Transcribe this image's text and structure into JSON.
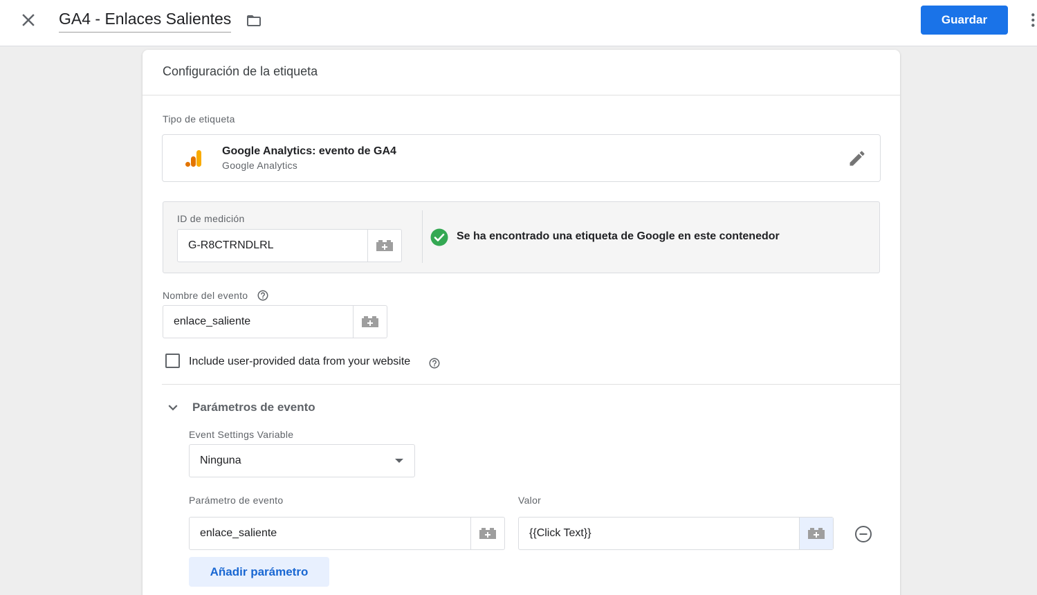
{
  "topbar": {
    "title": "GA4 - Enlaces Salientes",
    "save_label": "Guardar"
  },
  "card": {
    "title": "Configuración de la etiqueta",
    "tag_type_label": "Tipo de etiqueta",
    "tag_type": {
      "name": "Google Analytics: evento de GA4",
      "vendor": "Google Analytics"
    },
    "measurement_id": {
      "label": "ID de medición",
      "value": "G-R8CTRNDLRL",
      "status": "Se ha encontrado una etiqueta de Google en este contenedor"
    },
    "event_name": {
      "label": "Nombre del evento",
      "value": "enlace_saliente"
    },
    "user_data_checkbox": {
      "label": "Include user-provided data from your website",
      "checked": false
    },
    "event_params": {
      "title": "Parámetros de evento",
      "settings_variable_label": "Event Settings Variable",
      "settings_variable_value": "Ninguna",
      "param_header": "Parámetro de evento",
      "value_header": "Valor",
      "rows": [
        {
          "param": "enlace_saliente",
          "value": "{{Click Text}}"
        }
      ],
      "add_label": "Añadir parámetro"
    }
  },
  "colors": {
    "primary": "#1a73e8",
    "success": "#34a853",
    "ga_orange": "#f9ab00",
    "ga_dark_orange": "#e37400"
  }
}
